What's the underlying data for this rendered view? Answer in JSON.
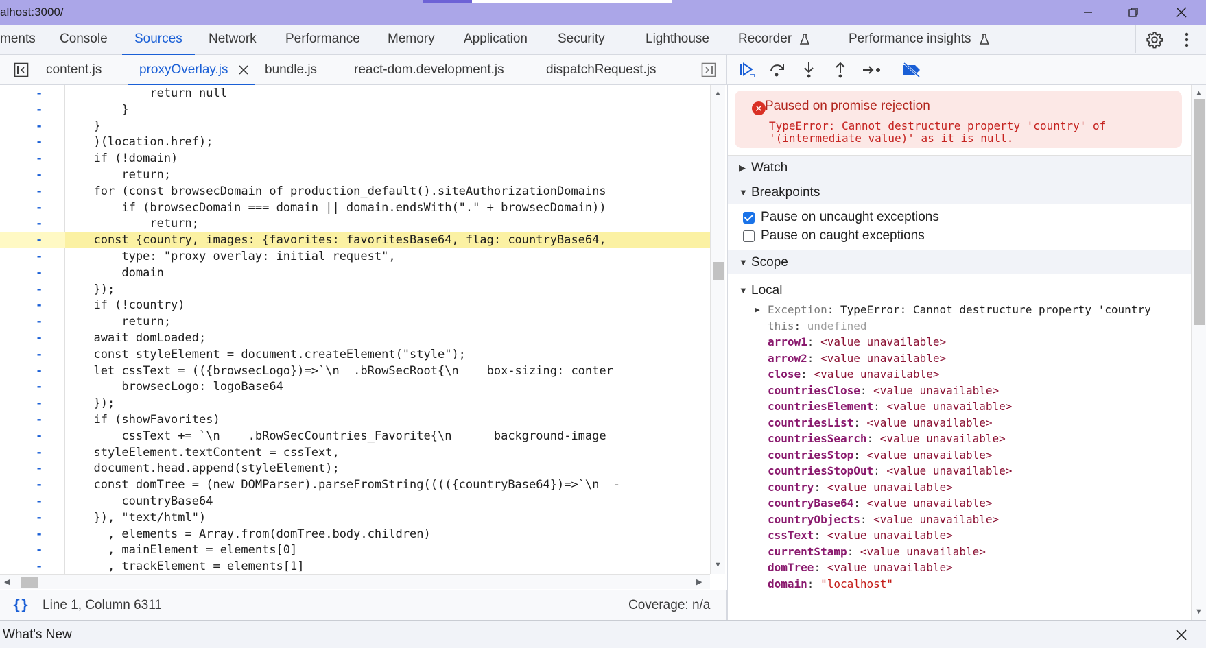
{
  "titlebar": {
    "url": "alhost:3000/"
  },
  "panel_tabs": [
    {
      "label": "ments"
    },
    {
      "label": "Console"
    },
    {
      "label": "Sources"
    },
    {
      "label": "Network"
    },
    {
      "label": "Performance"
    },
    {
      "label": "Memory"
    },
    {
      "label": "Application"
    },
    {
      "label": "Security"
    },
    {
      "label": "Lighthouse"
    },
    {
      "label": "Recorder"
    },
    {
      "label": "Performance insights"
    }
  ],
  "file_tabs": [
    {
      "label": "content.js"
    },
    {
      "label": "proxyOverlay.js"
    },
    {
      "label": "bundle.js"
    },
    {
      "label": "react-dom.development.js"
    },
    {
      "label": "dispatchRequest.js"
    }
  ],
  "code_lines": [
    "          return null",
    "      }",
    "  }",
    "  )(location.href);",
    "  if (!domain)",
    "      return;",
    "  for (const browsecDomain of production_default().siteAuthorizationDomains",
    "      if (browsecDomain === domain || domain.endsWith(\".\" + browsecDomain))",
    "          return;",
    "  const {country, images: {favorites: favoritesBase64, flag: countryBase64,",
    "      type: \"proxy overlay: initial request\",",
    "      domain",
    "  });",
    "  if (!country)",
    "      return;",
    "  await domLoaded;",
    "  const styleElement = document.createElement(\"style\");",
    "  let cssText = (({browsecLogo})=>`\\n  .bRowSecRoot{\\n    box-sizing: conter",
    "      browsecLogo: logoBase64",
    "  });",
    "  if (showFavorites)",
    "      cssText += `\\n    .bRowSecCountries_Favorite{\\n      background-image",
    "  styleElement.textContent = cssText,",
    "  document.head.append(styleElement);",
    "  const domTree = (new DOMParser).parseFromString(((({countryBase64})=>`\\n  -",
    "      countryBase64",
    "  }), \"text/html\")",
    "    , elements = Array.from(domTree.body.children)",
    "    , mainElement = elements[0]",
    "    , trackElement = elements[1]"
  ],
  "gutter_marker": "-",
  "status": {
    "position": "Line 1, Column 6311",
    "coverage": "Coverage: n/a",
    "braces": "{}"
  },
  "pause": {
    "title": "Paused on promise rejection",
    "message": "TypeError: Cannot destructure property 'country' of '(intermediate value)' as it is null."
  },
  "sections": {
    "watch": "Watch",
    "breakpoints": "Breakpoints",
    "scope": "Scope",
    "local": "Local"
  },
  "checkboxes": [
    {
      "label": "Pause on uncaught exceptions",
      "checked": true
    },
    {
      "label": "Pause on caught exceptions",
      "checked": false
    }
  ],
  "scope_vars": [
    {
      "key": "Exception",
      "value": "TypeError: Cannot destructure property 'country"
    },
    {
      "key": "this",
      "value": "undefined"
    },
    {
      "key": "arrow1",
      "value": "<value unavailable>"
    },
    {
      "key": "arrow2",
      "value": "<value unavailable>"
    },
    {
      "key": "close",
      "value": "<value unavailable>"
    },
    {
      "key": "countriesClose",
      "value": "<value unavailable>"
    },
    {
      "key": "countriesElement",
      "value": "<value unavailable>"
    },
    {
      "key": "countriesList",
      "value": "<value unavailable>"
    },
    {
      "key": "countriesSearch",
      "value": "<value unavailable>"
    },
    {
      "key": "countriesStop",
      "value": "<value unavailable>"
    },
    {
      "key": "countriesStopOut",
      "value": "<value unavailable>"
    },
    {
      "key": "country",
      "value": "<value unavailable>"
    },
    {
      "key": "countryBase64",
      "value": "<value unavailable>"
    },
    {
      "key": "countryObjects",
      "value": "<value unavailable>"
    },
    {
      "key": "cssText",
      "value": "<value unavailable>"
    },
    {
      "key": "currentStamp",
      "value": "<value unavailable>"
    },
    {
      "key": "domTree",
      "value": "<value unavailable>"
    },
    {
      "key": "domain",
      "value": "\"localhost\""
    }
  ],
  "drawer": {
    "label": "What's New"
  },
  "colors": {
    "accent": "#1a5fd6",
    "titlebar": "#aba6e8",
    "highlight": "#fbf1a3",
    "error": "#c5221f"
  }
}
